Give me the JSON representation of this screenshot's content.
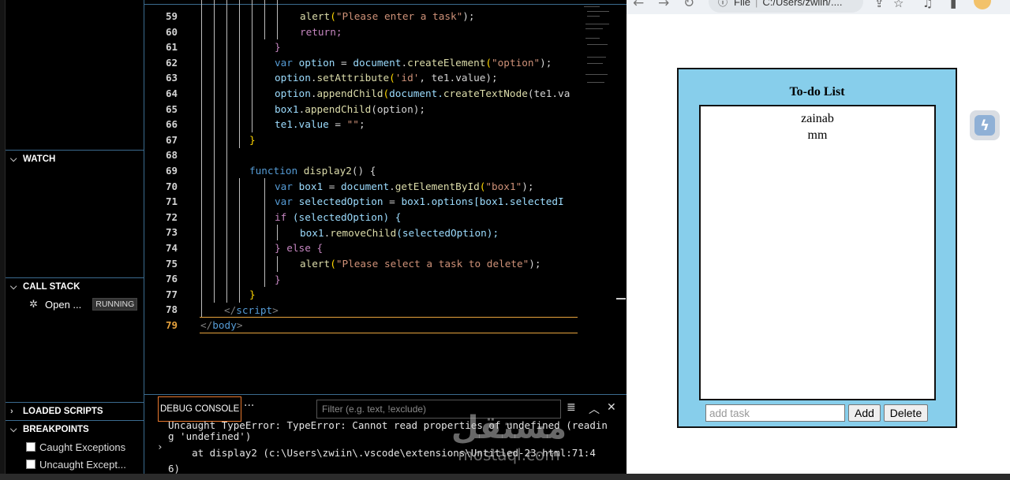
{
  "sidebar": {
    "watch": {
      "label": "WATCH"
    },
    "call_stack": {
      "label": "CALL STACK",
      "frame_label": "Open ...",
      "frame_status": "RUNNING"
    },
    "loaded_scripts": {
      "label": "LOADED SCRIPTS"
    },
    "breakpoints": {
      "label": "BREAKPOINTS",
      "items": [
        "Caught Exceptions",
        "Uncaught Except..."
      ]
    }
  },
  "editor": {
    "line_numbers": [
      "59",
      "60",
      "61",
      "62",
      "63",
      "64",
      "65",
      "66",
      "67",
      "68",
      "69",
      "70",
      "71",
      "72",
      "73",
      "74",
      "75",
      "76",
      "77",
      "78",
      "79"
    ],
    "current_line": "79",
    "code": {
      "l59": {
        "fn": "alert",
        "str": "\"Please enter a task\"",
        "tail": ");"
      },
      "l60": "return;",
      "l61": "}",
      "l62": {
        "kw": "var",
        "name": "option",
        "eq": " = ",
        "obj": "document",
        "fn": "createElement",
        "str": "\"option\"",
        "tail": ");"
      },
      "l63": {
        "obj": "option",
        "fn": "setAttribute",
        "str": "'id'",
        "rest": ", te1.value);"
      },
      "l64": {
        "obj": "option",
        "fn": "appendChild",
        "rest1": "document.",
        "fn2": "createTextNode",
        "rest2": "(te1.va"
      },
      "l65": {
        "obj": "box1",
        "fn": "appendChild",
        "rest": "(option);"
      },
      "l66": {
        "obj": "te1.value",
        "eq": " = ",
        "str": "\"\"",
        "tail": ";"
      },
      "l67": "}",
      "l69": {
        "kw": "function",
        "fn": "display2",
        "tail": "() {"
      },
      "l70": {
        "kw": "var",
        "name": "box1",
        "eq": " = ",
        "obj": "document",
        "fn": "getElementById",
        "str": "\"box1\"",
        "tail": ");"
      },
      "l71": {
        "kw": "var",
        "name": "selectedOption",
        "eq": " = ",
        "rest": "box1.options[box1.selectedI"
      },
      "l72": {
        "kw": "if",
        "rest": " (selectedOption) {"
      },
      "l73": {
        "obj": "box1",
        "fn": "removeChild",
        "rest": "(selectedOption);"
      },
      "l74": {
        "brace": "} ",
        "kw": "else",
        "tail": " {"
      },
      "l75": {
        "fn": "alert",
        "str": "\"Please select a task to delete\"",
        "tail": ");"
      },
      "l76": "}",
      "l77": "}",
      "l78": {
        "open": "</",
        "tag": "script",
        "close": ">"
      },
      "l79": {
        "open": "</",
        "tag": "body",
        "close": ">"
      }
    }
  },
  "console": {
    "tab_label": "DEBUG CONSOLE",
    "more": "···",
    "filter_placeholder": "Filter (e.g. text, !exclude)",
    "lines": [
      "Uncaught TypeError: TypeError: Cannot read properties of undefined (readin",
      "g 'undefined')",
      "    at display2 (c:\\Users\\zwiin\\.vscode\\extensions\\Untitled-23.html:71:4",
      "6)"
    ]
  },
  "browser": {
    "url_prefix": "File",
    "url": "C:/Users/zwiin/....",
    "todo": {
      "title": "To-do List",
      "items": [
        "zainab",
        "mm"
      ],
      "input_placeholder": "add task",
      "add_label": "Add",
      "delete_label": "Delete"
    }
  },
  "watermark": {
    "arabic": "مستقل",
    "latin": "mostaql.com"
  }
}
